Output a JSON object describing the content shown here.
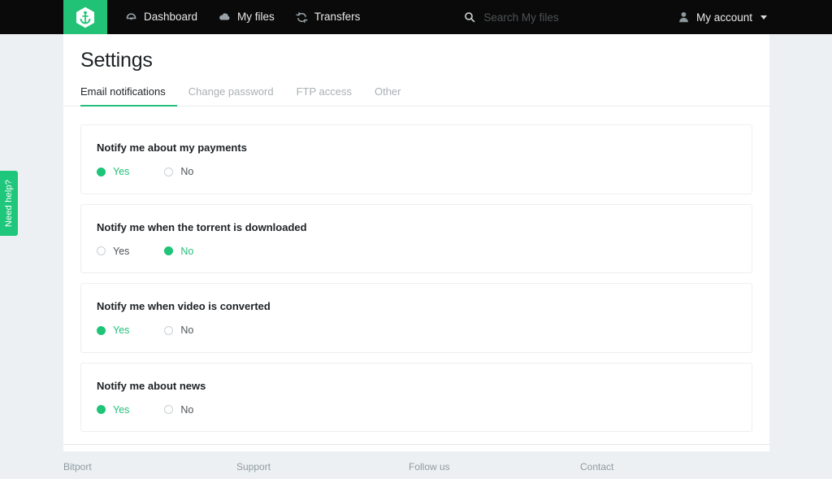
{
  "nav": {
    "logo_icon": "anchor-hexagon-logo",
    "links": [
      {
        "label": "Dashboard",
        "icon": "dashboard-gauge-icon"
      },
      {
        "label": "My files",
        "icon": "cloud-icon"
      },
      {
        "label": "Transfers",
        "icon": "sync-refresh-icon"
      }
    ],
    "search": {
      "placeholder": "Search My files",
      "value": "",
      "icon": "search-icon"
    },
    "account": {
      "label": "My account",
      "icon": "user-icon",
      "caret": "chevron-down-icon"
    }
  },
  "help_tab": {
    "label": "Need help?"
  },
  "page": {
    "title": "Settings",
    "tabs": [
      {
        "label": "Email notifications",
        "active": true
      },
      {
        "label": "Change password",
        "active": false
      },
      {
        "label": "FTP access",
        "active": false
      },
      {
        "label": "Other",
        "active": false
      }
    ]
  },
  "settings": {
    "yes_label": "Yes",
    "no_label": "No",
    "items": [
      {
        "title": "Notify me about my payments",
        "selected": "yes"
      },
      {
        "title": "Notify me when the torrent is downloaded",
        "selected": "no"
      },
      {
        "title": "Notify me when video is converted",
        "selected": "yes"
      },
      {
        "title": "Notify me about news",
        "selected": "yes"
      }
    ]
  },
  "footer": {
    "columns": [
      {
        "label": "Bitport"
      },
      {
        "label": "Support"
      },
      {
        "label": "Follow us"
      },
      {
        "label": "Contact"
      }
    ]
  },
  "colors": {
    "brand_green": "#1ec478",
    "nav_background": "#0a0a0a",
    "page_background": "#edf0f2",
    "panel_background": "#ffffff",
    "muted_text": "#a9b0b4"
  }
}
